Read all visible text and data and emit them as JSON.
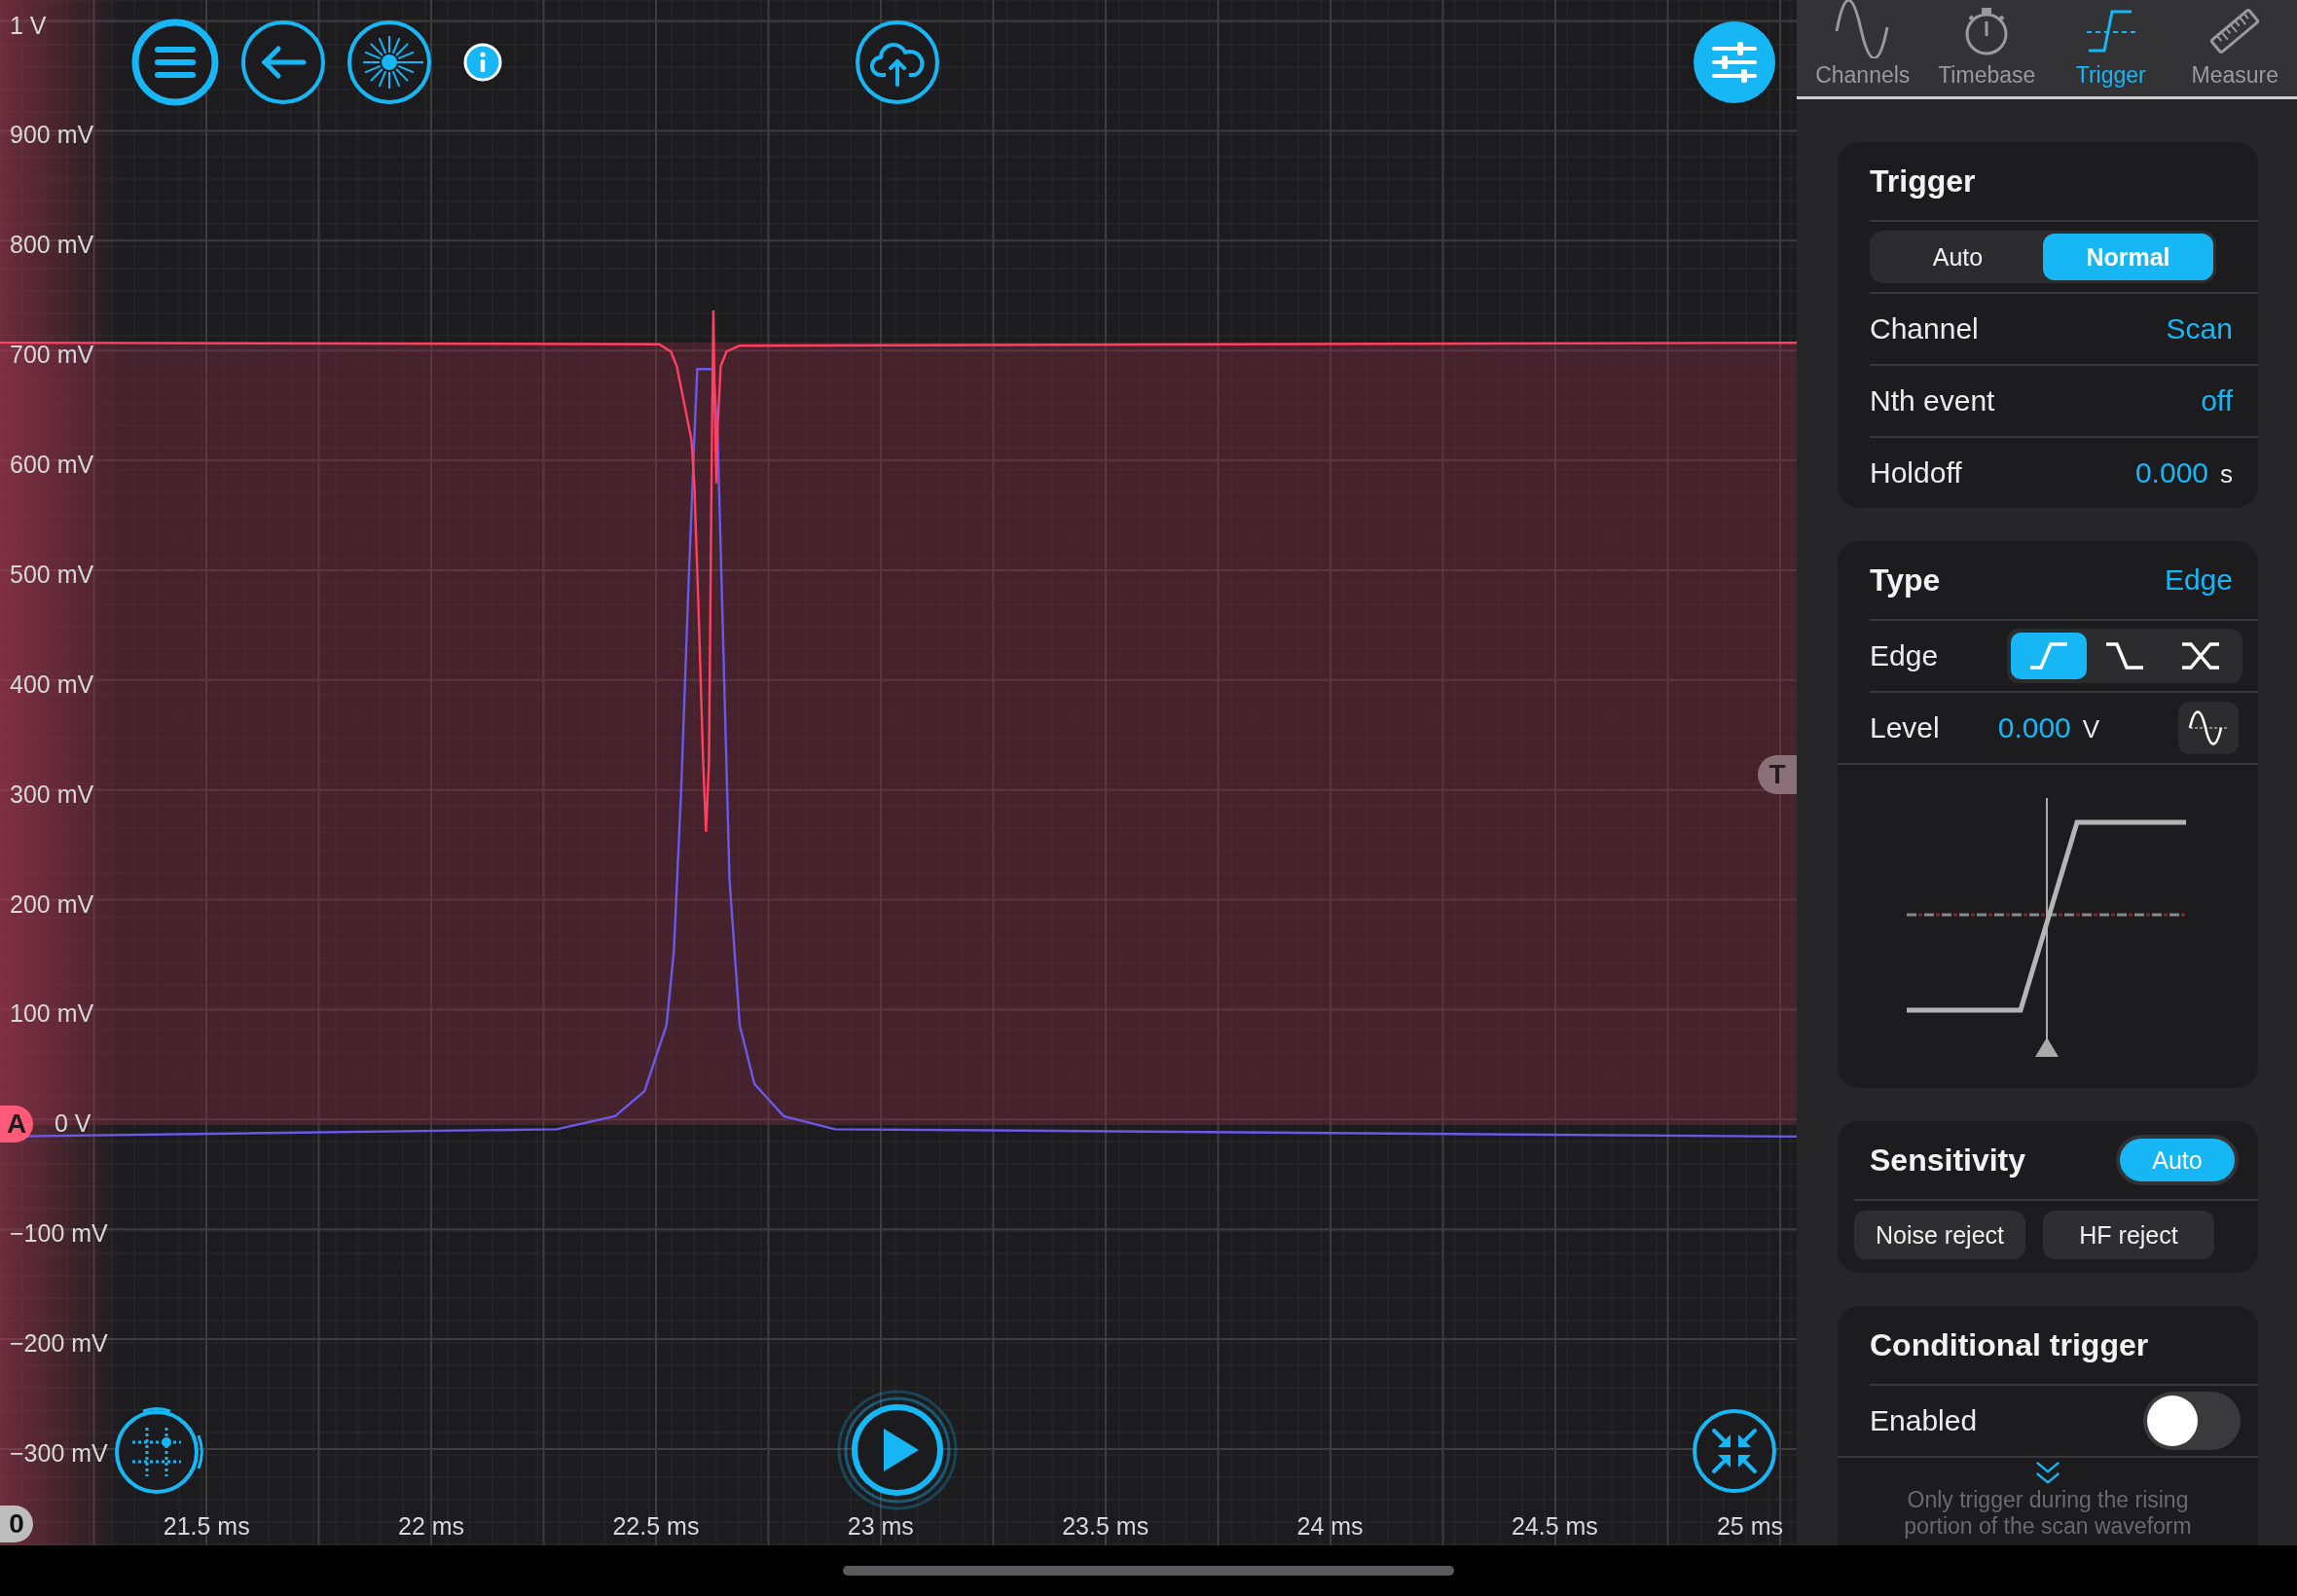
{
  "scope": {
    "y_labels": [
      "1 V",
      "900 mV",
      "800 mV",
      "700 mV",
      "600 mV",
      "500 mV",
      "400 mV",
      "300 mV",
      "200 mV",
      "100 mV",
      "0 V",
      "−100 mV",
      "−200 mV",
      "−300 mV"
    ],
    "x_labels": [
      "21.5 ms",
      "22 ms",
      "22.5 ms",
      "23 ms",
      "23.5 ms",
      "24 ms",
      "24.5 ms",
      "25 ms"
    ],
    "channel_marker": "A",
    "ground_marker": "0",
    "trigger_marker": "T"
  },
  "tabs": [
    {
      "label": "Channels",
      "selected": false
    },
    {
      "label": "Timebase",
      "selected": false
    },
    {
      "label": "Trigger",
      "selected": true
    },
    {
      "label": "Measure",
      "selected": false
    }
  ],
  "trigger_card": {
    "title": "Trigger",
    "modes": [
      {
        "label": "Auto",
        "selected": false
      },
      {
        "label": "Normal",
        "selected": true
      }
    ],
    "rows": [
      {
        "label": "Channel",
        "value": "Scan"
      },
      {
        "label": "Nth event",
        "value": "off"
      },
      {
        "label": "Holdoff",
        "value": "0.000",
        "unit": "s"
      }
    ]
  },
  "type_card": {
    "title": "Type",
    "value": "Edge",
    "edge": {
      "label": "Edge",
      "options": [
        {
          "kind": "rising",
          "selected": true
        },
        {
          "kind": "falling",
          "selected": false
        },
        {
          "kind": "either",
          "selected": false
        }
      ]
    },
    "level": {
      "label": "Level",
      "value": "0.000",
      "unit": "V"
    }
  },
  "sensitivity_card": {
    "title": "Sensitivity",
    "mode": {
      "label": "Auto",
      "selected": true
    },
    "filters": [
      {
        "label": "Noise reject",
        "on": false
      },
      {
        "label": "HF reject",
        "on": false
      }
    ]
  },
  "conditional_card": {
    "title": "Conditional trigger",
    "enabled": {
      "label": "Enabled",
      "on": false
    },
    "note": "Only trigger during the rising portion of the scan waveform"
  }
}
